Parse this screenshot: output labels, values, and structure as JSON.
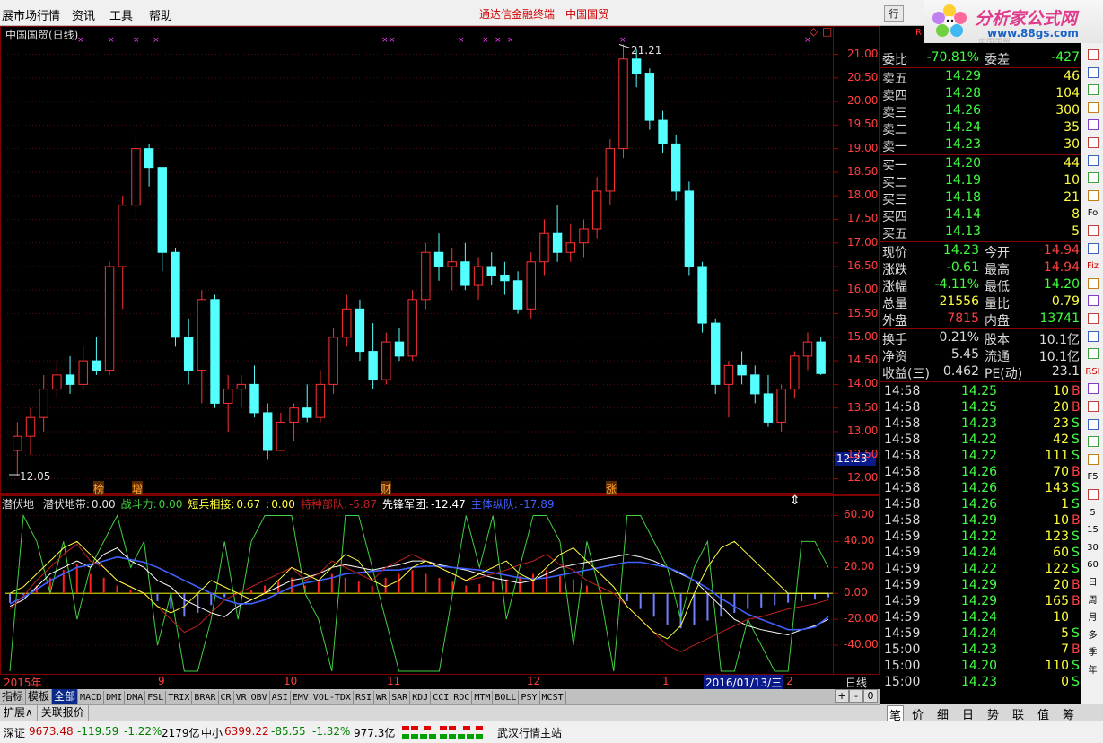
{
  "menu": {
    "items": [
      "展市场行情",
      "资讯",
      "工具",
      "帮助"
    ],
    "center_app": "通达信金融终端",
    "center_stock": "中国国贸",
    "win_btn": "行"
  },
  "logo": {
    "name": "分析家公式网",
    "url": "www.88gs.com",
    "watermark": "R",
    "sub_watermark": "中国国贸"
  },
  "chart": {
    "title": "中国国贸(日线)",
    "high_label": "21.21",
    "low_label": "12.05",
    "current_price_label": "12.23",
    "price_axis": [
      "21.00",
      "20.50",
      "20.00",
      "19.50",
      "19.00",
      "18.50",
      "18.00",
      "17.50",
      "17.00",
      "16.50",
      "16.00",
      "15.50",
      "15.00",
      "14.50",
      "14.00",
      "13.50",
      "13.00",
      "12.50",
      "12.00"
    ],
    "event_markers": [
      "榜",
      "增",
      "财",
      "涨"
    ],
    "top_icons": [
      "□",
      "◇"
    ]
  },
  "chart_data": {
    "type": "candlestick",
    "series_name": "中国国贸(日线)",
    "ylim": [
      11.8,
      21.6
    ],
    "up_color": "#ff3232",
    "down_color": "#54ffff",
    "ohlc": [
      [
        12.6,
        13.2,
        12.05,
        12.9
      ],
      [
        12.9,
        13.5,
        12.5,
        13.3
      ],
      [
        13.3,
        14.2,
        13.0,
        13.9
      ],
      [
        13.9,
        14.5,
        13.7,
        14.2
      ],
      [
        14.2,
        14.6,
        13.8,
        14.0
      ],
      [
        14.0,
        14.8,
        13.9,
        14.5
      ],
      [
        14.5,
        15.0,
        14.2,
        14.3
      ],
      [
        14.3,
        16.6,
        14.2,
        16.5
      ],
      [
        16.5,
        18.0,
        15.6,
        17.8
      ],
      [
        17.8,
        19.3,
        17.5,
        19.0
      ],
      [
        19.0,
        19.1,
        18.2,
        18.6
      ],
      [
        18.6,
        18.6,
        16.4,
        16.8
      ],
      [
        16.8,
        16.9,
        14.8,
        15.0
      ],
      [
        15.0,
        15.4,
        14.0,
        14.3
      ],
      [
        14.3,
        16.0,
        13.6,
        15.8
      ],
      [
        15.8,
        15.9,
        13.5,
        13.6
      ],
      [
        13.6,
        14.2,
        13.0,
        13.9
      ],
      [
        13.9,
        14.2,
        13.5,
        14.0
      ],
      [
        14.0,
        14.4,
        13.3,
        13.4
      ],
      [
        13.4,
        13.6,
        12.4,
        12.6
      ],
      [
        12.6,
        13.4,
        12.6,
        13.2
      ],
      [
        13.2,
        13.6,
        12.8,
        13.5
      ],
      [
        13.5,
        14.0,
        13.2,
        13.3
      ],
      [
        13.3,
        14.3,
        13.2,
        14.0
      ],
      [
        14.0,
        15.2,
        13.8,
        15.0
      ],
      [
        15.0,
        15.9,
        14.8,
        15.6
      ],
      [
        15.6,
        15.8,
        14.5,
        14.7
      ],
      [
        14.7,
        15.3,
        13.9,
        14.1
      ],
      [
        14.1,
        15.1,
        14.0,
        14.9
      ],
      [
        14.9,
        15.2,
        14.5,
        14.6
      ],
      [
        14.6,
        16.0,
        14.5,
        15.8
      ],
      [
        15.8,
        17.0,
        15.6,
        16.8
      ],
      [
        16.8,
        17.2,
        16.2,
        16.5
      ],
      [
        16.5,
        16.9,
        16.0,
        16.6
      ],
      [
        16.6,
        17.0,
        16.0,
        16.1
      ],
      [
        16.1,
        16.7,
        15.8,
        16.5
      ],
      [
        16.5,
        16.8,
        16.1,
        16.3
      ],
      [
        16.3,
        16.6,
        15.9,
        16.2
      ],
      [
        16.2,
        16.4,
        15.5,
        15.6
      ],
      [
        15.6,
        16.8,
        15.4,
        16.6
      ],
      [
        16.6,
        17.5,
        16.3,
        17.2
      ],
      [
        17.2,
        17.8,
        16.6,
        16.8
      ],
      [
        16.8,
        17.4,
        16.6,
        17.0
      ],
      [
        17.0,
        17.5,
        16.7,
        17.3
      ],
      [
        17.3,
        18.4,
        17.1,
        18.1
      ],
      [
        18.1,
        19.2,
        17.8,
        19.0
      ],
      [
        19.0,
        21.21,
        18.8,
        20.9
      ],
      [
        20.9,
        21.1,
        20.3,
        20.6
      ],
      [
        20.6,
        20.7,
        19.4,
        19.6
      ],
      [
        19.6,
        19.8,
        18.9,
        19.1
      ],
      [
        19.1,
        19.3,
        17.9,
        18.1
      ],
      [
        18.1,
        18.3,
        16.3,
        16.5
      ],
      [
        16.5,
        16.6,
        15.1,
        15.3
      ],
      [
        15.3,
        15.4,
        13.8,
        14.0
      ],
      [
        14.0,
        14.5,
        13.3,
        14.4
      ],
      [
        14.4,
        14.7,
        14.0,
        14.2
      ],
      [
        14.2,
        14.4,
        13.6,
        13.8
      ],
      [
        13.8,
        14.2,
        13.1,
        13.2
      ],
      [
        13.2,
        14.0,
        13.0,
        13.9
      ],
      [
        13.9,
        14.7,
        13.7,
        14.6
      ],
      [
        14.6,
        15.1,
        14.3,
        14.9
      ],
      [
        14.9,
        15.0,
        14.2,
        14.23
      ]
    ],
    "volume": null
  },
  "indicator": {
    "name": "潜伏地",
    "legend": [
      {
        "label": "潜伏地带:",
        "value": "0.00",
        "color": "#e0e0e0"
      },
      {
        "label": "战斗力:",
        "value": "0.00",
        "color": "#40d040"
      },
      {
        "label": "短兵相接:",
        "value": "0.67",
        "color": "#ffff40"
      },
      {
        "label": ":",
        "value": "0.00",
        "color": "#ffff40"
      },
      {
        "label": "特种部队:",
        "value": "-5.87",
        "color": "#c02020"
      },
      {
        "label": "先锋军团:",
        "value": "-12.47",
        "color": "#ffffff"
      },
      {
        "label": "主体纵队:",
        "value": "-17.89",
        "color": "#4060ff"
      }
    ],
    "axis": [
      "60.00",
      "40.00",
      "20.00",
      "0.00",
      "-20.00",
      "-40.00"
    ],
    "ylim": [
      -60,
      70
    ],
    "series": [
      {
        "name": "战斗力",
        "color": "#40d040",
        "values": [
          -60,
          60,
          40,
          0,
          40,
          -20,
          20,
          40,
          60,
          20,
          40,
          -40,
          0,
          -60,
          -60,
          -20,
          40,
          -20,
          40,
          60,
          60,
          60,
          0,
          -20,
          -60,
          60,
          60,
          20,
          -20,
          -60,
          -60,
          -60,
          -60,
          0,
          60,
          20,
          60,
          -20,
          20,
          60,
          60,
          40,
          -40,
          40,
          0,
          -60,
          60,
          60,
          40,
          20,
          -20,
          20,
          40,
          -60,
          -60,
          -20,
          -40,
          -60,
          -60,
          40,
          40,
          20
        ]
      },
      {
        "name": "先锋军团",
        "color": "#ffffff",
        "values": [
          -10,
          -5,
          5,
          15,
          20,
          25,
          20,
          30,
          35,
          25,
          20,
          10,
          5,
          -5,
          -10,
          -15,
          -18,
          -10,
          -5,
          0,
          5,
          10,
          12,
          15,
          20,
          22,
          20,
          18,
          20,
          22,
          25,
          25,
          22,
          20,
          18,
          15,
          12,
          10,
          8,
          10,
          15,
          20,
          22,
          24,
          26,
          28,
          30,
          28,
          25,
          20,
          15,
          10,
          0,
          -10,
          -20,
          -25,
          -28,
          -30,
          -32,
          -28,
          -25,
          -20
        ]
      },
      {
        "name": "主体纵队",
        "color": "#4060ff",
        "values": [
          -8,
          -3,
          3,
          10,
          15,
          20,
          22,
          25,
          28,
          26,
          24,
          20,
          15,
          10,
          5,
          0,
          -5,
          -8,
          -8,
          -5,
          0,
          5,
          8,
          10,
          12,
          15,
          16,
          17,
          18,
          18,
          20,
          21,
          21,
          20,
          19,
          18,
          16,
          14,
          12,
          11,
          12,
          14,
          16,
          18,
          20,
          22,
          24,
          24,
          22,
          20,
          16,
          10,
          4,
          -4,
          -10,
          -16,
          -20,
          -24,
          -28,
          -28,
          -26,
          -18
        ]
      },
      {
        "name": "特种部队",
        "color": "#c02020",
        "values": [
          -12,
          -2,
          10,
          20,
          30,
          38,
          25,
          20,
          10,
          5,
          0,
          -10,
          -20,
          -30,
          -25,
          -15,
          -5,
          0,
          5,
          10,
          15,
          20,
          10,
          15,
          25,
          20,
          15,
          10,
          20,
          25,
          30,
          25,
          20,
          15,
          10,
          12,
          15,
          18,
          22,
          25,
          30,
          22,
          18,
          10,
          5,
          0,
          -10,
          -20,
          -30,
          -40,
          -45,
          -40,
          -35,
          -30,
          -25,
          -20,
          -18,
          -15,
          -12,
          -10,
          -8,
          -5
        ]
      },
      {
        "name": "短兵相接",
        "color": "#ffff40",
        "values": [
          0,
          5,
          15,
          25,
          35,
          40,
          30,
          20,
          10,
          5,
          0,
          -10,
          -15,
          -10,
          0,
          10,
          5,
          0,
          -5,
          0,
          10,
          20,
          15,
          10,
          20,
          30,
          25,
          10,
          5,
          10,
          20,
          25,
          20,
          15,
          10,
          15,
          20,
          25,
          15,
          10,
          20,
          30,
          35,
          25,
          15,
          5,
          -10,
          -20,
          -30,
          -35,
          -25,
          0,
          20,
          35,
          40,
          30,
          20,
          10,
          0,
          0,
          0,
          0
        ]
      }
    ]
  },
  "date_axis": {
    "labels": [
      "2015年",
      "9",
      "10",
      "11",
      "12",
      "1",
      "2"
    ],
    "selected_date": "2016/01/13/三",
    "period": "日线"
  },
  "bottom_tabs": [
    "指标",
    "模板",
    "全部",
    "MACD",
    "DMI",
    "DMA",
    "FSL",
    "TRIX",
    "BRAR",
    "CR",
    "VR",
    "OBV",
    "ASI",
    "EMV",
    "VOL-TDX",
    "RSI",
    "WR",
    "SAR",
    "KDJ",
    "CCI",
    "ROC",
    "MTM",
    "BOLL",
    "PSY",
    "MCST"
  ],
  "bottom_tabs_active": "全部",
  "bottom_tabs_right": [
    "+",
    "-",
    "0"
  ],
  "ext_bar": [
    "扩展∧",
    "关联报价"
  ],
  "quote": {
    "weibi": {
      "l1": "委比",
      "v1": "-70.81%",
      "l2": "委差",
      "v2": "-427"
    },
    "sells": [
      {
        "l": "卖五",
        "p": "14.29",
        "v": "46"
      },
      {
        "l": "卖四",
        "p": "14.28",
        "v": "104"
      },
      {
        "l": "卖三",
        "p": "14.26",
        "v": "300"
      },
      {
        "l": "卖二",
        "p": "14.24",
        "v": "35"
      },
      {
        "l": "卖一",
        "p": "14.23",
        "v": "30"
      }
    ],
    "buys": [
      {
        "l": "买一",
        "p": "14.20",
        "v": "44"
      },
      {
        "l": "买二",
        "p": "14.19",
        "v": "10"
      },
      {
        "l": "买三",
        "p": "14.18",
        "v": "21"
      },
      {
        "l": "买四",
        "p": "14.14",
        "v": "8"
      },
      {
        "l": "买五",
        "p": "14.13",
        "v": "5"
      }
    ],
    "stats": [
      {
        "l1": "现价",
        "v1": "14.23",
        "c1": "#40ff40",
        "l2": "今开",
        "v2": "14.94",
        "c2": "#ff4040"
      },
      {
        "l1": "涨跌",
        "v1": "-0.61",
        "c1": "#40ff40",
        "l2": "最高",
        "v2": "14.94",
        "c2": "#ff4040"
      },
      {
        "l1": "涨幅",
        "v1": "-4.11%",
        "c1": "#40ff40",
        "l2": "最低",
        "v2": "14.20",
        "c2": "#40ff40"
      },
      {
        "l1": "总量",
        "v1": "21556",
        "c1": "#ffff40",
        "l2": "量比",
        "v2": "0.79",
        "c2": "#ffff40"
      },
      {
        "l1": "外盘",
        "v1": "7815",
        "c1": "#ff4040",
        "l2": "内盘",
        "v2": "13741",
        "c2": "#40ff40"
      }
    ],
    "fin": [
      {
        "l1": "换手",
        "v1": "0.21%",
        "l2": "股本",
        "v2": "10.1亿"
      },
      {
        "l1": "净资",
        "v1": "5.45",
        "l2": "流通",
        "v2": "10.1亿"
      },
      {
        "l1": "收益(三)",
        "v1": "0.462",
        "l2": "PE(动)",
        "v2": "23.1"
      }
    ],
    "ticks": [
      {
        "t": "14:58",
        "p": "14.25",
        "v": "10",
        "s": "B"
      },
      {
        "t": "14:58",
        "p": "14.25",
        "v": "20",
        "s": "B"
      },
      {
        "t": "14:58",
        "p": "14.23",
        "v": "23",
        "s": "S"
      },
      {
        "t": "14:58",
        "p": "14.22",
        "v": "42",
        "s": "S"
      },
      {
        "t": "14:58",
        "p": "14.22",
        "v": "111",
        "s": "S"
      },
      {
        "t": "14:58",
        "p": "14.26",
        "v": "70",
        "s": "B"
      },
      {
        "t": "14:58",
        "p": "14.26",
        "v": "143",
        "s": "S"
      },
      {
        "t": "14:58",
        "p": "14.26",
        "v": "1",
        "s": "S"
      },
      {
        "t": "14:58",
        "p": "14.29",
        "v": "10",
        "s": "B"
      },
      {
        "t": "14:59",
        "p": "14.22",
        "v": "123",
        "s": "S"
      },
      {
        "t": "14:59",
        "p": "14.24",
        "v": "60",
        "s": "S"
      },
      {
        "t": "14:59",
        "p": "14.22",
        "v": "122",
        "s": "S"
      },
      {
        "t": "14:59",
        "p": "14.29",
        "v": "20",
        "s": "B"
      },
      {
        "t": "14:59",
        "p": "14.29",
        "v": "165",
        "s": "B"
      },
      {
        "t": "14:59",
        "p": "14.24",
        "v": "10",
        "s": ""
      },
      {
        "t": "14:59",
        "p": "14.24",
        "v": "5",
        "s": "S"
      },
      {
        "t": "15:00",
        "p": "14.23",
        "v": "7",
        "s": "B"
      },
      {
        "t": "15:00",
        "p": "14.20",
        "v": "110",
        "s": "S"
      },
      {
        "t": "15:00",
        "p": "14.23",
        "v": "0",
        "s": "S"
      }
    ]
  },
  "right_tabs": [
    "笔",
    "价",
    "细",
    "日",
    "势",
    "联",
    "值",
    "筹"
  ],
  "toolbar": [
    "",
    "",
    "",
    "",
    "",
    "",
    "",
    "",
    "",
    "Fo",
    "",
    "",
    "Fiz",
    "",
    "",
    "",
    "",
    "",
    "RSI",
    "",
    "",
    "",
    "",
    "",
    "F5",
    "",
    "5",
    "15",
    "30",
    "60",
    "日",
    "周",
    "月",
    "多",
    "季",
    "年"
  ],
  "status": {
    "sz_label": "深证",
    "sz_value": "9673.48",
    "sz_change": "-119.59",
    "sz_pct": "-1.22%",
    "sz_amount": "2179亿",
    "zx_label": "中小",
    "zx_value": "6399.22",
    "zx_change": "-85.55",
    "zx_pct": "-1.32%",
    "zx_amount": "977.3亿",
    "station": "武汉行情主站"
  }
}
